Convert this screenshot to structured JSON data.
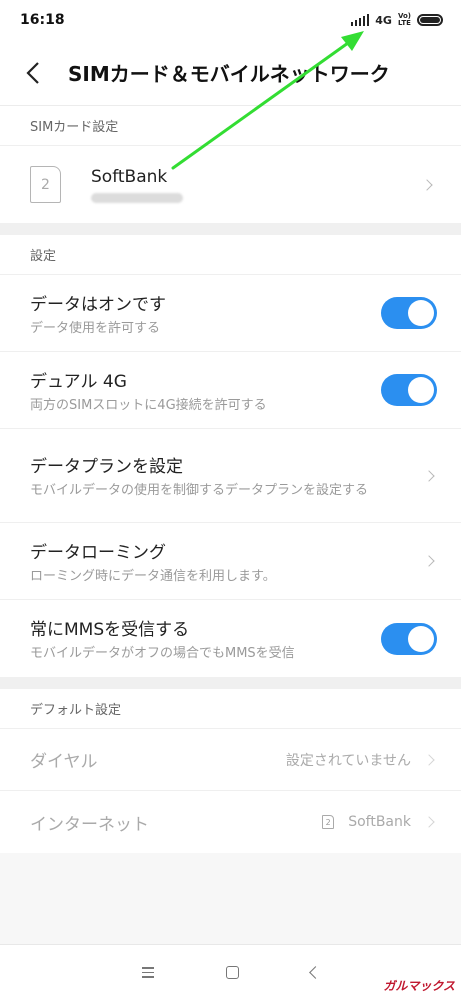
{
  "status_bar": {
    "time": "16:18",
    "network": "4G",
    "volte_top": "Vo)",
    "volte_bottom": "LTE",
    "icons": [
      "signal-icon",
      "volte-icon",
      "battery-icon"
    ]
  },
  "header": {
    "title": "SIMカード＆モバイルネットワーク",
    "back_icon": "back-arrow-icon"
  },
  "sim_section": {
    "header": "SIMカード設定",
    "sim": {
      "slot": "2",
      "name": "SoftBank"
    }
  },
  "settings_section": {
    "header": "設定",
    "items": [
      {
        "title": "データはオンです",
        "subtitle": "データ使用を許可する",
        "control": "toggle",
        "on": true
      },
      {
        "title": "デュアル 4G",
        "subtitle": "両方のSIMスロットに4G接続を許可する",
        "control": "toggle",
        "on": true
      },
      {
        "title": "データプランを設定",
        "subtitle": "モバイルデータの使用を制御するデータプランを設定する",
        "control": "chevron"
      },
      {
        "title": "データローミング",
        "subtitle": "ローミング時にデータ通信を利用します。",
        "control": "chevron"
      },
      {
        "title": "常にMMSを受信する",
        "subtitle": "モバイルデータがオフの場合でもMMSを受信",
        "control": "toggle",
        "on": true
      }
    ]
  },
  "default_section": {
    "header": "デフォルト設定",
    "items": [
      {
        "title": "ダイヤル",
        "value": "設定されていません"
      },
      {
        "title": "インターネット",
        "value": "SoftBank",
        "sim_slot": "2"
      }
    ]
  },
  "navbar": {
    "icons": [
      "menu-icon",
      "home-icon",
      "back-icon"
    ]
  },
  "watermark": "ガルマックス",
  "colors": {
    "toggle_on": "#2b8ff0",
    "annotation_arrow": "#33dd33",
    "watermark": "#c0182f"
  }
}
